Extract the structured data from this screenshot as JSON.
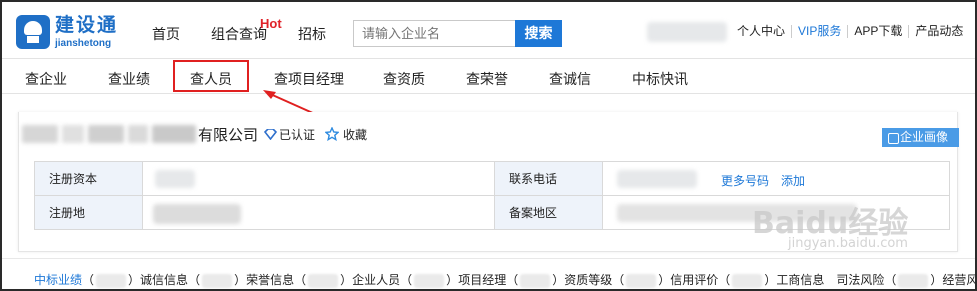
{
  "brand": {
    "name_cn": "建设通",
    "name_en": "jianshetong",
    "color": "#1f6fc6"
  },
  "main_nav": [
    "首页",
    "组合查询",
    "招标"
  ],
  "hot_badge": "Hot",
  "search": {
    "placeholder": "请输入企业名",
    "button": "搜索"
  },
  "user_menu": [
    "个人中心",
    "VIP服务",
    "APP下载",
    "产品动态"
  ],
  "sub_nav": [
    "查企业",
    "查业绩",
    "查人员",
    "查项目经理",
    "查资质",
    "查荣誉",
    "查诚信",
    "中标快讯"
  ],
  "highlighted_sub_nav": "查人员",
  "company": {
    "name_suffix": "有限公司",
    "verified_label": "已认证",
    "favorite_label": "收藏",
    "portrait_button": "企业画像"
  },
  "info_table": {
    "registered_capital_label": "注册资本",
    "phone_label": "联系电话",
    "more_numbers": "更多号码",
    "add": "添加",
    "registered_address_label": "注册地",
    "filing_region_label": "备案地区"
  },
  "bottom_tabs": [
    "中标业绩",
    "诚信信息",
    "荣誉信息",
    "企业人员",
    "项目经理",
    "资质等级",
    "信用评价",
    "工商信息",
    "司法风险",
    "经营风险"
  ],
  "watermark": {
    "main": "Baidu经验",
    "sub": "jingyan.baidu.com"
  },
  "colors": {
    "accent": "#1e78d7",
    "hot": "#e0232a",
    "annotation": "#e02020"
  }
}
